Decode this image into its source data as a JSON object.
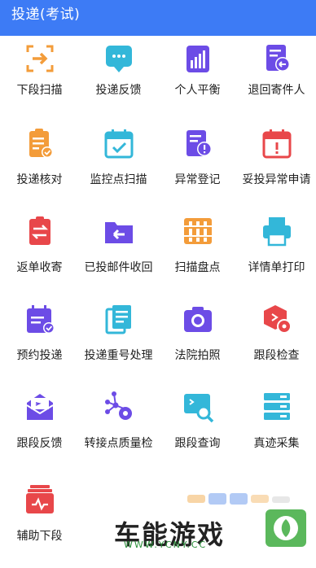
{
  "header": {
    "title": "投递(考试)"
  },
  "colors": {
    "header_bg": "#3d7bf5"
  },
  "items": [
    {
      "label": "下段扫描",
      "icon": "scan-frame-icon",
      "color": "#f39c3a"
    },
    {
      "label": "投递反馈",
      "icon": "chat-bubble-icon",
      "color": "#33b7d9"
    },
    {
      "label": "个人平衡",
      "icon": "bar-chart-icon",
      "color": "#6c4ce6"
    },
    {
      "label": "退回寄件人",
      "icon": "return-document-icon",
      "color": "#6c4ce6"
    },
    {
      "label": "投递核对",
      "icon": "clipboard-check-icon",
      "color": "#f39c3a"
    },
    {
      "label": "监控点扫描",
      "icon": "calendar-check-icon",
      "color": "#33b7d9"
    },
    {
      "label": "异常登记",
      "icon": "document-alert-icon",
      "color": "#6c4ce6"
    },
    {
      "label": "妥投异常申请",
      "icon": "calendar-alert-icon",
      "color": "#e8474a"
    },
    {
      "label": "返单收寄",
      "icon": "clipboard-transfer-icon",
      "color": "#e8474a"
    },
    {
      "label": "已投邮件收回",
      "icon": "folder-return-icon",
      "color": "#6c4ce6"
    },
    {
      "label": "扫描盘点",
      "icon": "abacus-icon",
      "color": "#f39c3a"
    },
    {
      "label": "详情单打印",
      "icon": "printer-icon",
      "color": "#33b7d9"
    },
    {
      "label": "预约投递",
      "icon": "calendar-list-icon",
      "color": "#6c4ce6"
    },
    {
      "label": "投递重号处理",
      "icon": "documents-stack-icon",
      "color": "#33b7d9"
    },
    {
      "label": "法院拍照",
      "icon": "camera-icon",
      "color": "#6c4ce6"
    },
    {
      "label": "跟段检查",
      "icon": "box-gear-icon",
      "color": "#e8474a"
    },
    {
      "label": "跟段反馈",
      "icon": "mail-open-icon",
      "color": "#6c4ce6"
    },
    {
      "label": "转接点质量检",
      "icon": "network-gear-icon",
      "color": "#6c4ce6"
    },
    {
      "label": "跟段查询",
      "icon": "monitor-search-icon",
      "color": "#33b7d9"
    },
    {
      "label": "真迹采集",
      "icon": "server-stack-icon",
      "color": "#33b7d9"
    },
    {
      "label": "辅助下段",
      "icon": "card-stack-icon",
      "color": "#e8474a"
    }
  ],
  "watermark": {
    "brand": "车能游戏",
    "url": "WWW.YCNY.CC"
  }
}
